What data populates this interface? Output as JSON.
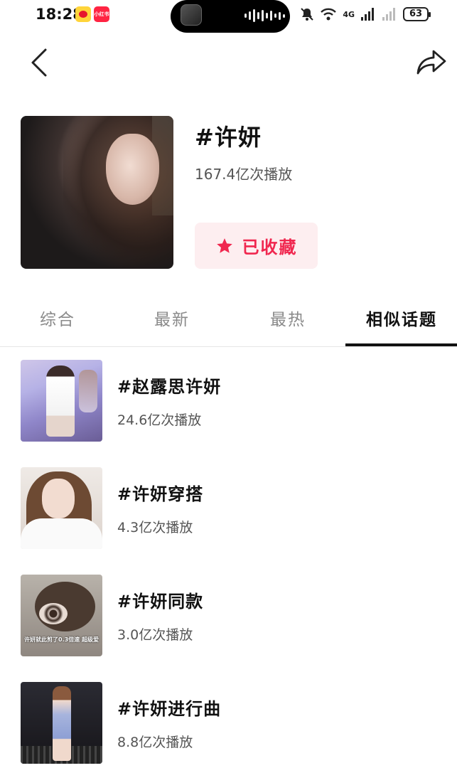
{
  "status_bar": {
    "time": "18:28",
    "app_badges": [
      "weibo-icon",
      "xiaohongshu-icon"
    ],
    "network": "4G",
    "battery": "63"
  },
  "nav": {
    "back_icon": "chevron-left-icon",
    "share_icon": "share-arrow-icon"
  },
  "topic": {
    "title": "#许妍",
    "plays": "167.4亿次播放",
    "favorite_label": "已收藏",
    "favorite_color": "#f0274f"
  },
  "tabs": [
    {
      "label": "综合",
      "active": false
    },
    {
      "label": "最新",
      "active": false
    },
    {
      "label": "最热",
      "active": false
    },
    {
      "label": "相似话题",
      "active": true
    }
  ],
  "similar_topics": [
    {
      "title": "#赵露思许妍",
      "plays": "24.6亿次播放"
    },
    {
      "title": "#许妍穿搭",
      "plays": "4.3亿次播放"
    },
    {
      "title": "#许妍同款",
      "plays": "3.0亿次播放",
      "thumb_caption": "许妍就此剪了0.3倍速 超级爱"
    },
    {
      "title": "#许妍进行曲",
      "plays": "8.8亿次播放"
    }
  ]
}
